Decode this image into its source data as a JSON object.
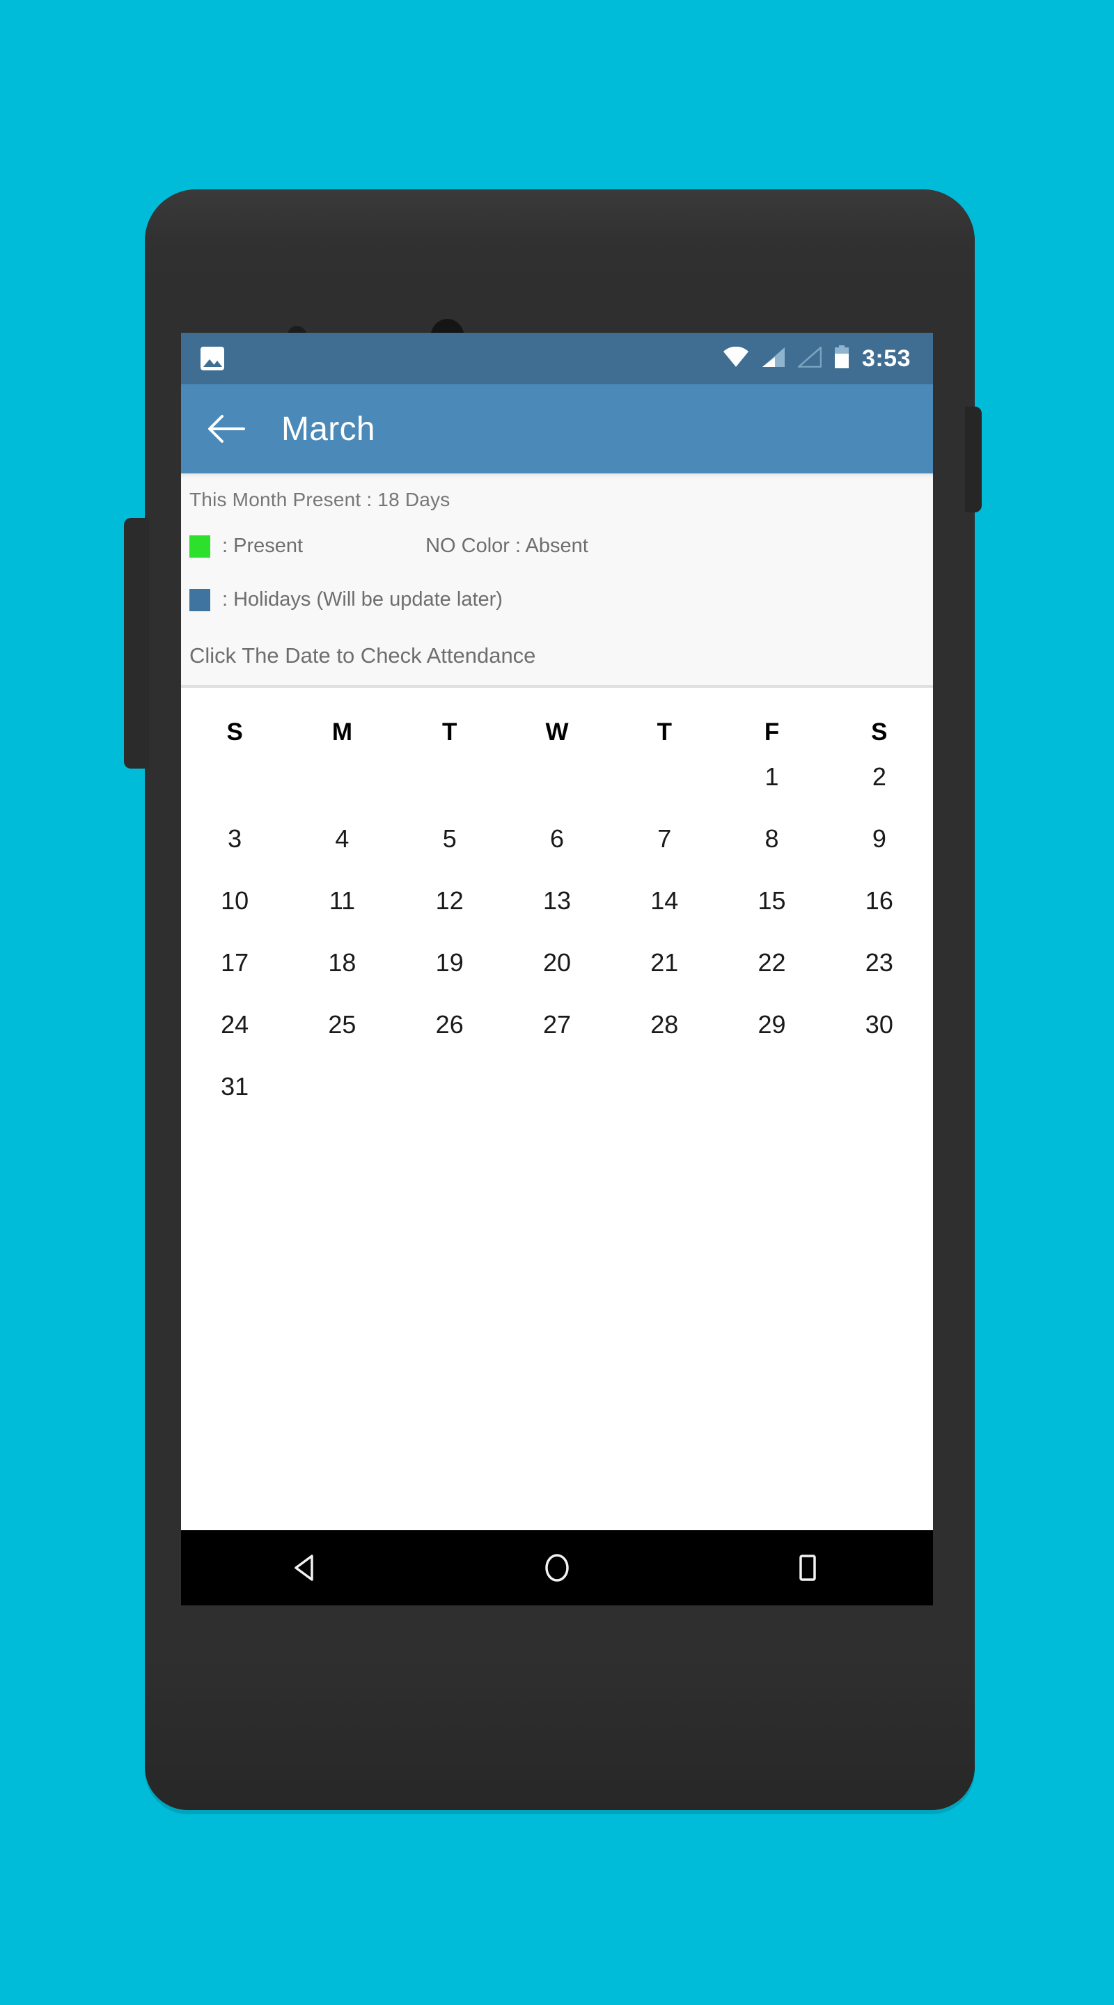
{
  "background_color": "#00bcd8",
  "device": {
    "frame_color": "#2f2f2f",
    "sensor_icon": "proximity-sensor",
    "camera_icon": "front-camera",
    "volume_button": "volume-rocker",
    "power_button": "power-button"
  },
  "status_bar": {
    "background_color": "#3f6e92",
    "left_icon": "photo-icon",
    "icons": [
      "wifi-icon",
      "signal-icon",
      "signal-empty-icon",
      "battery-icon"
    ],
    "time": "3:53"
  },
  "app_bar": {
    "background_color": "#4a89b8",
    "back_icon": "back-arrow-icon",
    "title": "March"
  },
  "info_card": {
    "summary": "This Month Present : 18 Days",
    "legend": [
      {
        "swatch_color": "#2ce02c",
        "label": ": Present"
      },
      {
        "swatch_color": "#3f74a0",
        "label": ": Holidays (Will be update later)"
      }
    ],
    "absent_note": "NO Color  : Absent",
    "hint": "Click The Date to Check Attendance"
  },
  "calendar": {
    "weekdays": [
      "S",
      "M",
      "T",
      "W",
      "T",
      "F",
      "S"
    ],
    "present_dot_color": "#19e019",
    "weeks": [
      [
        {
          "day": "",
          "present": false
        },
        {
          "day": "",
          "present": false
        },
        {
          "day": "",
          "present": false
        },
        {
          "day": "",
          "present": false
        },
        {
          "day": "",
          "present": false
        },
        {
          "day": "1",
          "present": true
        },
        {
          "day": "2",
          "present": false
        }
      ],
      [
        {
          "day": "3",
          "present": false
        },
        {
          "day": "4",
          "present": false
        },
        {
          "day": "5",
          "present": true
        },
        {
          "day": "6",
          "present": true
        },
        {
          "day": "7",
          "present": true
        },
        {
          "day": "8",
          "present": true
        },
        {
          "day": "9",
          "present": false
        }
      ],
      [
        {
          "day": "10",
          "present": false
        },
        {
          "day": "11",
          "present": true
        },
        {
          "day": "12",
          "present": true
        },
        {
          "day": "13",
          "present": true
        },
        {
          "day": "14",
          "present": true
        },
        {
          "day": "15",
          "present": true
        },
        {
          "day": "16",
          "present": false
        }
      ],
      [
        {
          "day": "17",
          "present": false
        },
        {
          "day": "18",
          "present": true
        },
        {
          "day": "19",
          "present": true
        },
        {
          "day": "20",
          "present": true
        },
        {
          "day": "21",
          "present": false
        },
        {
          "day": "22",
          "present": true
        },
        {
          "day": "23",
          "present": false
        }
      ],
      [
        {
          "day": "24",
          "present": false
        },
        {
          "day": "25",
          "present": true
        },
        {
          "day": "26",
          "present": true
        },
        {
          "day": "27",
          "present": true
        },
        {
          "day": "28",
          "present": true
        },
        {
          "day": "29",
          "present": false
        },
        {
          "day": "30",
          "present": false
        }
      ],
      [
        {
          "day": "31",
          "present": false
        },
        {
          "day": "",
          "present": false
        },
        {
          "day": "",
          "present": false
        },
        {
          "day": "",
          "present": false
        },
        {
          "day": "",
          "present": false
        },
        {
          "day": "",
          "present": false
        },
        {
          "day": "",
          "present": false
        }
      ]
    ]
  },
  "nav_bar": {
    "background_color": "#000000",
    "buttons": [
      "back-nav-icon",
      "home-nav-icon",
      "recents-nav-icon"
    ]
  }
}
